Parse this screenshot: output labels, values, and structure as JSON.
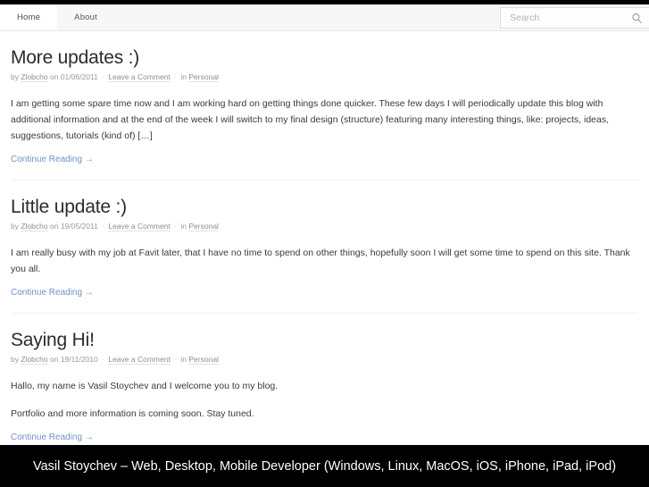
{
  "header": {
    "nav": [
      {
        "label": "Home",
        "active": true
      },
      {
        "label": "About",
        "active": false
      }
    ],
    "search": {
      "placeholder": "Search",
      "value": "",
      "icon": "search-icon"
    }
  },
  "posts": [
    {
      "title": "More updates :)",
      "meta": {
        "by_label": "by",
        "author": "Zlobcho",
        "on_label": "on",
        "date": "01/06/2011",
        "comments": "Leave a Comment",
        "in_label": "in",
        "category": "Personal"
      },
      "paragraphs": [
        "I am getting some spare time now and I am working hard on getting things done quicker. These few days I will periodically update this blog with additional information and at the end of the week I will switch to my final design (structure) featuring many interesting things, like: projects, ideas, suggestions, tutorials (kind of) […]"
      ],
      "continue_label": "Continue Reading →"
    },
    {
      "title": "Little update :)",
      "meta": {
        "by_label": "by",
        "author": "Zlobcho",
        "on_label": "on",
        "date": "19/05/2011",
        "comments": "Leave a Comment",
        "in_label": "in",
        "category": "Personal"
      },
      "paragraphs": [
        "I am really busy with my job at Favit later, that I have no time to spend on other things, hopefully soon I will get some time to spend on this site. Thank you all."
      ],
      "continue_label": "Continue Reading →"
    },
    {
      "title": "Saying Hi!",
      "meta": {
        "by_label": "by",
        "author": "Zlobcho",
        "on_label": "on",
        "date": "19/11/2010",
        "comments": "Leave a Comment",
        "in_label": "in",
        "category": "Personal"
      },
      "paragraphs": [
        "Hallo, my name is Vasil Stoychev and I welcome you to my blog.",
        "Portfolio and more information is coming soon. Stay tuned."
      ],
      "continue_label": "Continue Reading →"
    }
  ],
  "footer": {
    "text": "Vasil Stoychev – Web, Desktop, Mobile Developer (Windows, Linux, MacOS, iOS, iPhone, iPad, iPod)"
  },
  "colors": {
    "accent_link": "#6f93c4",
    "footer_bg": "#000000",
    "header_bg": "#f7f7f7",
    "title_text": "#2c2c2c"
  }
}
